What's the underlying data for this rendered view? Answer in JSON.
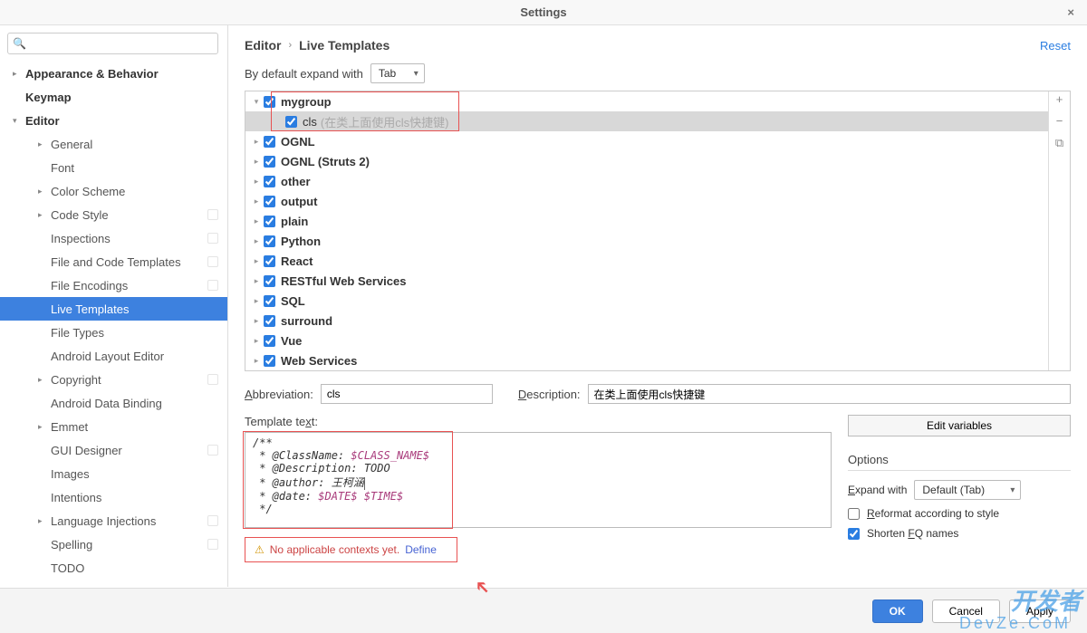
{
  "window": {
    "title": "Settings"
  },
  "search": {
    "placeholder": ""
  },
  "sidebar": {
    "items": [
      {
        "label": "Appearance & Behavior",
        "bold": true,
        "arrow": "▸",
        "indent": 0
      },
      {
        "label": "Keymap",
        "bold": true,
        "arrow": "",
        "indent": 0
      },
      {
        "label": "Editor",
        "bold": true,
        "arrow": "▾",
        "indent": 0
      },
      {
        "label": "General",
        "arrow": "▸",
        "indent": 1
      },
      {
        "label": "Font",
        "arrow": "",
        "indent": 1
      },
      {
        "label": "Color Scheme",
        "arrow": "▸",
        "indent": 1
      },
      {
        "label": "Code Style",
        "arrow": "▸",
        "indent": 1,
        "cfg": true
      },
      {
        "label": "Inspections",
        "arrow": "",
        "indent": 1,
        "cfg": true
      },
      {
        "label": "File and Code Templates",
        "arrow": "",
        "indent": 1,
        "cfg": true
      },
      {
        "label": "File Encodings",
        "arrow": "",
        "indent": 1,
        "cfg": true
      },
      {
        "label": "Live Templates",
        "arrow": "",
        "indent": 1,
        "selected": true
      },
      {
        "label": "File Types",
        "arrow": "",
        "indent": 1
      },
      {
        "label": "Android Layout Editor",
        "arrow": "",
        "indent": 1
      },
      {
        "label": "Copyright",
        "arrow": "▸",
        "indent": 1,
        "cfg": true
      },
      {
        "label": "Android Data Binding",
        "arrow": "",
        "indent": 1
      },
      {
        "label": "Emmet",
        "arrow": "▸",
        "indent": 1
      },
      {
        "label": "GUI Designer",
        "arrow": "",
        "indent": 1,
        "cfg": true
      },
      {
        "label": "Images",
        "arrow": "",
        "indent": 1
      },
      {
        "label": "Intentions",
        "arrow": "",
        "indent": 1
      },
      {
        "label": "Language Injections",
        "arrow": "▸",
        "indent": 1,
        "cfg": true
      },
      {
        "label": "Spelling",
        "arrow": "",
        "indent": 1,
        "cfg": true
      },
      {
        "label": "TODO",
        "arrow": "",
        "indent": 1
      }
    ]
  },
  "breadcrumb": {
    "root": "Editor",
    "leaf": "Live Templates",
    "reset": "Reset"
  },
  "default_expand": {
    "label": "By default expand with",
    "value": "Tab"
  },
  "templates": [
    {
      "name": "mygroup",
      "arrow": "▾",
      "checked": true,
      "indent": 0
    },
    {
      "name": "cls",
      "desc": "(在类上面使用cls快捷键)",
      "arrow": "",
      "checked": true,
      "indent": 1,
      "selected": true,
      "redbox": true
    },
    {
      "name": "OGNL",
      "arrow": "▸",
      "checked": true,
      "indent": 0
    },
    {
      "name": "OGNL (Struts 2)",
      "arrow": "▸",
      "checked": true,
      "indent": 0
    },
    {
      "name": "other",
      "arrow": "▸",
      "checked": true,
      "indent": 0
    },
    {
      "name": "output",
      "arrow": "▸",
      "checked": true,
      "indent": 0
    },
    {
      "name": "plain",
      "arrow": "▸",
      "checked": true,
      "indent": 0
    },
    {
      "name": "Python",
      "arrow": "▸",
      "checked": true,
      "indent": 0
    },
    {
      "name": "React",
      "arrow": "▸",
      "checked": true,
      "indent": 0
    },
    {
      "name": "RESTful Web Services",
      "arrow": "▸",
      "checked": true,
      "indent": 0
    },
    {
      "name": "SQL",
      "arrow": "▸",
      "checked": true,
      "indent": 0
    },
    {
      "name": "surround",
      "arrow": "▸",
      "checked": true,
      "indent": 0
    },
    {
      "name": "Vue",
      "arrow": "▸",
      "checked": true,
      "indent": 0
    },
    {
      "name": "Web Services",
      "arrow": "▸",
      "checked": true,
      "indent": 0
    }
  ],
  "toolbar": {
    "add": "+",
    "remove": "−",
    "copy": "⧉"
  },
  "form": {
    "abbr_label": "Abbreviation:",
    "abbr_value": "cls",
    "desc_label": "Description:",
    "desc_value": "在类上面使用cls快捷键",
    "tmpl_label": "Template text:"
  },
  "template_code": {
    "l1": "/**",
    "l2a": " * @ClassName: ",
    "l2b": "$CLASS_NAME$",
    "l3": " * @Description: TODO",
    "l4a": " * @author: 王柯涵",
    "l5a": " * @date: ",
    "l5b": "$DATE$ $TIME$",
    "l6": " */"
  },
  "context": {
    "warn": "No applicable contexts yet.",
    "define": "Define"
  },
  "edit_vars_btn": "Edit variables",
  "options": {
    "title": "Options",
    "expand_label": "Expand with",
    "expand_value": "Default (Tab)",
    "reformat": "Reformat according to style",
    "reformat_checked": false,
    "shorten": "Shorten FQ names",
    "shorten_checked": true
  },
  "footer": {
    "ok": "OK",
    "cancel": "Cancel",
    "apply": "Apply"
  },
  "watermark": {
    "main": "开发者",
    "sub": "DevZe.CoM"
  }
}
